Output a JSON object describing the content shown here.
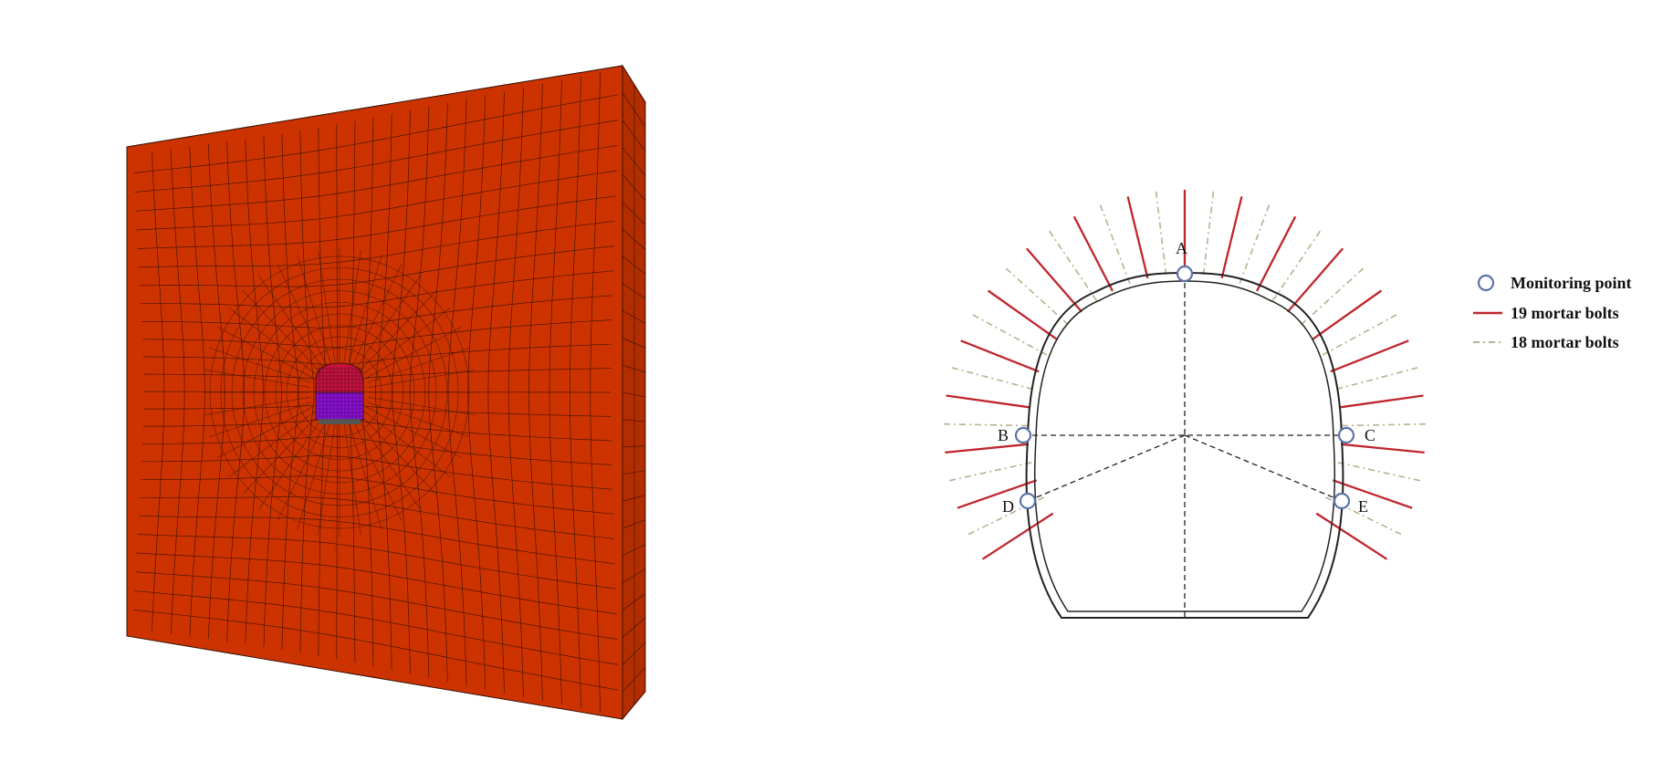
{
  "colors": {
    "block_face": "#cc3300",
    "block_side": "#b22d00",
    "block_top": "#d8450a",
    "mesh_line": "#3a1204",
    "upper_bench": "#c8123c",
    "lower_bench": "#8b10d6",
    "invert": "#555555",
    "mortar_bolt_19": "#c0262e",
    "mortar_bolt_18": "#b7b18f",
    "monitoring_point": "#5b73a8",
    "lining": "#222222",
    "dashed_guides": "#222222"
  },
  "monitoring_points": [
    {
      "label": "A"
    },
    {
      "label": "B"
    },
    {
      "label": "C"
    },
    {
      "label": "D"
    },
    {
      "label": "E"
    }
  ],
  "legend": {
    "monitoring_point": "Monitoring point",
    "bolts_19": "19 mortar bolts",
    "bolts_18": "18 mortar bolts"
  }
}
